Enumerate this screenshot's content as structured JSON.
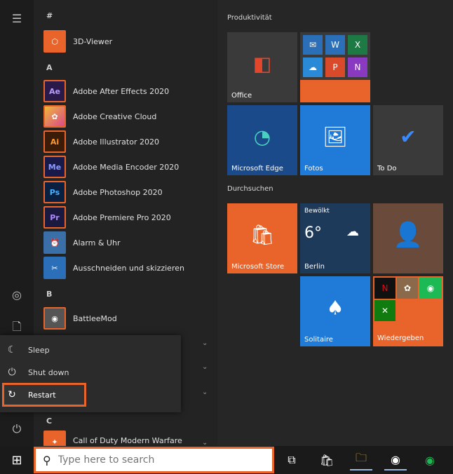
{
  "rail": {
    "menu_icon": "hamburger-icon",
    "user_icon": "user-icon",
    "docs_icon": "document-icon",
    "pics_icon": "pictures-icon",
    "settings_icon": "gear-icon",
    "power_icon": "power-icon"
  },
  "letters": {
    "hash": "#",
    "a": "A",
    "b": "B",
    "c": "C"
  },
  "apps": [
    {
      "label": "3D-Viewer",
      "icon_text": "⬡",
      "color": "#e8642a"
    },
    {
      "label": "Adobe After Effects 2020",
      "icon_text": "Ae",
      "color": "#2a1a4a"
    },
    {
      "label": "Adobe Creative Cloud",
      "icon_text": "✿",
      "color": "#c94a3a"
    },
    {
      "label": "Adobe Illustrator 2020",
      "icon_text": "Ai",
      "color": "#3a1c08"
    },
    {
      "label": "Adobe Media Encoder 2020",
      "icon_text": "Me",
      "color": "#1a1a4a"
    },
    {
      "label": "Adobe Photoshop 2020",
      "icon_text": "Ps",
      "color": "#0a2040"
    },
    {
      "label": "Adobe Premiere Pro 2020",
      "icon_text": "Pr",
      "color": "#1a1a40"
    },
    {
      "label": "Alarm & Uhr",
      "icon_text": "⏰",
      "color": "#3b6fa8"
    },
    {
      "label": "Ausschneiden und skizzieren",
      "icon_text": "✂",
      "color": "#2a6fb8"
    },
    {
      "label": "BattleeMod",
      "icon_text": "◉",
      "color": "#444"
    },
    {
      "label": "Call of Duty Modern Warfare",
      "icon_text": "✦",
      "color": "#e8642a"
    }
  ],
  "power_menu": {
    "sleep": "Sleep",
    "shutdown": "Shut down",
    "restart": "Restart"
  },
  "groups": {
    "productivity": "Produktivität",
    "browse": "Durchsuchen"
  },
  "tiles": {
    "office": "Office",
    "edge": "Microsoft Edge",
    "photos": "Fotos",
    "todo": "To Do",
    "store": "Microsoft Store",
    "weather_city": "Berlin",
    "weather_temp": "6°",
    "weather_label": "Bewölkt",
    "solitaire": "Solitaire",
    "play": "Wiedergeben"
  },
  "taskbar": {
    "search_placeholder": "Type here to search"
  }
}
